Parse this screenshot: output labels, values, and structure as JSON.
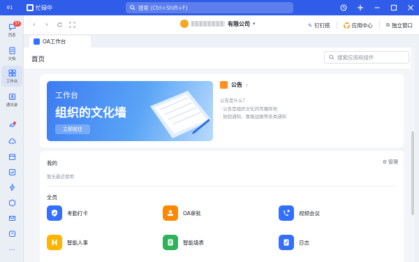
{
  "titlebar": {
    "badge": "01",
    "app_name": "忙碌中",
    "search_placeholder": "搜索 (Ctrl+Shift+F)"
  },
  "rail": {
    "messages_label": "消息",
    "messages_count": "37",
    "docs_label": "文档",
    "workbench_label": "工作台",
    "contacts_label": "通讯录",
    "more_label": "…"
  },
  "navbar": {
    "company_suffix": "有限公司",
    "dingdingzhao": "钉钉搭",
    "app_center": "应用中心",
    "detach": "独立窗口"
  },
  "tab": {
    "label": "OA工作台"
  },
  "page": {
    "title": "首页",
    "search_placeholder": "搜索应用和组件"
  },
  "banner": {
    "small": "工作台",
    "big": "组织的文化墙",
    "button": "立即前往"
  },
  "notice": {
    "title": "公告",
    "line1": "公告是什么？",
    "line2": "· 公告是组织文化的传播阵地",
    "line3": "· 放假通知、喜报战报等各类通知"
  },
  "mine": {
    "title": "我的",
    "manage": "管理",
    "empty": "暂无最近使用"
  },
  "all": {
    "title": "全员",
    "apps": [
      {
        "label": "考勤打卡",
        "color": "#3370ff"
      },
      {
        "label": "OA审批",
        "color": "#ff8800"
      },
      {
        "label": "视频会议",
        "color": "#3370ff"
      },
      {
        "label": "智能人事",
        "color": "#ffb400"
      },
      {
        "label": "智能填表",
        "color": "#2fb35a"
      },
      {
        "label": "日志",
        "color": "#3370ff"
      }
    ]
  }
}
